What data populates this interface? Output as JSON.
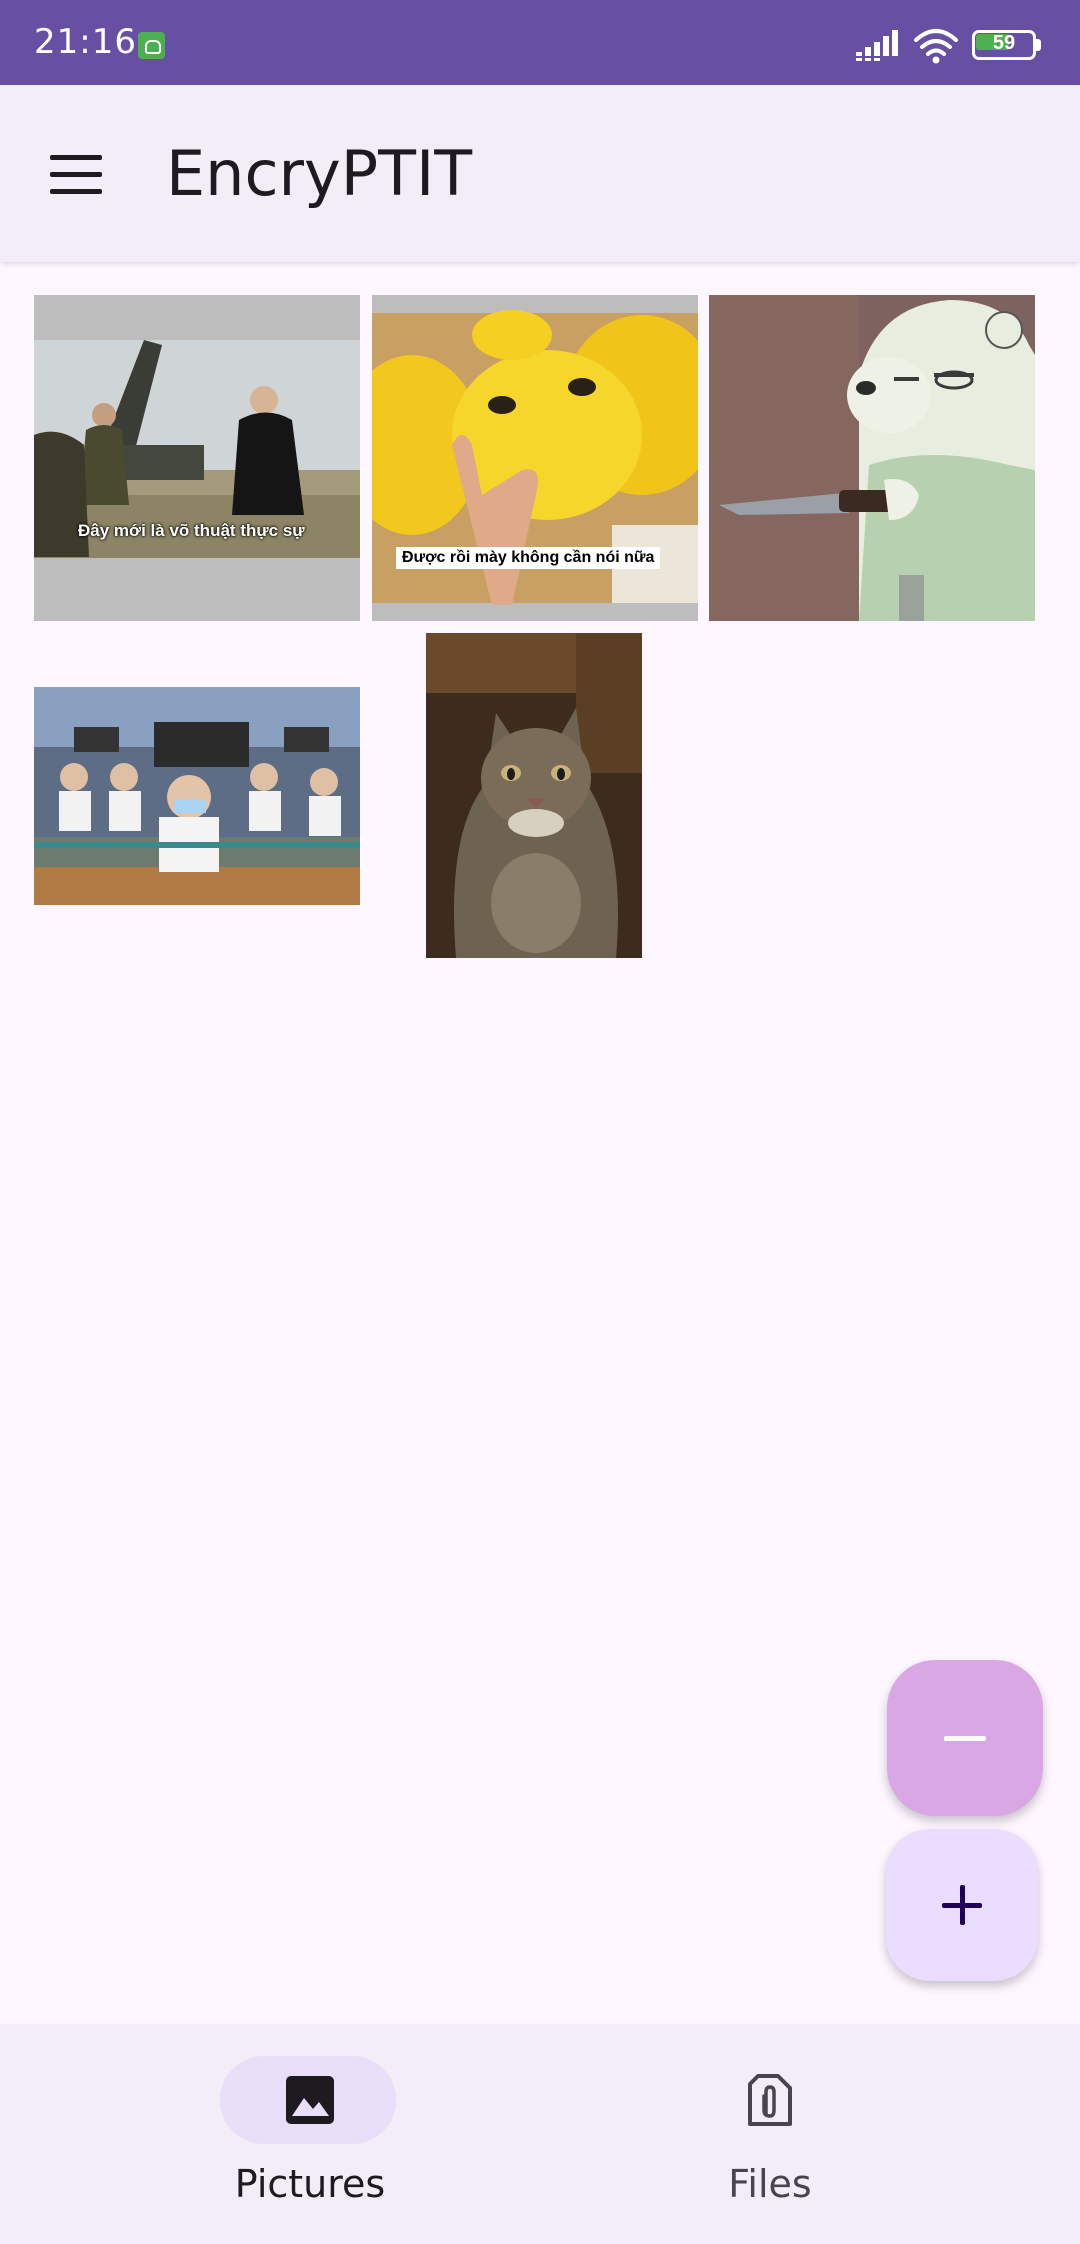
{
  "status_bar": {
    "time": "21:16",
    "battery_level": "59",
    "battery_fraction": 0.59,
    "icons": [
      "app-notification-icon",
      "signal-icon",
      "wifi-icon",
      "battery-icon"
    ]
  },
  "app_bar": {
    "title": "EncryPTIT",
    "menu_icon": "hamburger-menu-icon"
  },
  "pictures": [
    {
      "name": "military-meme",
      "caption": "Đây mới là võ thuật thực sự"
    },
    {
      "name": "yellow-plush-meme",
      "caption": "Được rồi mày không cần nói nữa"
    },
    {
      "name": "polar-bear-knife-meme",
      "caption": ""
    },
    {
      "name": "classroom-photo",
      "caption": ""
    },
    {
      "name": "sad-cat-photo",
      "caption": ""
    }
  ],
  "fabs": {
    "remove_icon": "minus-icon",
    "add_icon": "plus-icon"
  },
  "bottom_nav": {
    "items": [
      {
        "label": "Pictures",
        "icon": "image-icon",
        "selected": true
      },
      {
        "label": "Files",
        "icon": "paperclip-file-icon",
        "selected": false
      }
    ]
  },
  "colors": {
    "primary": "#6750a4",
    "surface_container": "#f3edf7",
    "background": "#fef7ff",
    "fab_remove": "#d9a7e3",
    "fab_add": "#eaddff",
    "nav_indicator": "#e8def8"
  }
}
